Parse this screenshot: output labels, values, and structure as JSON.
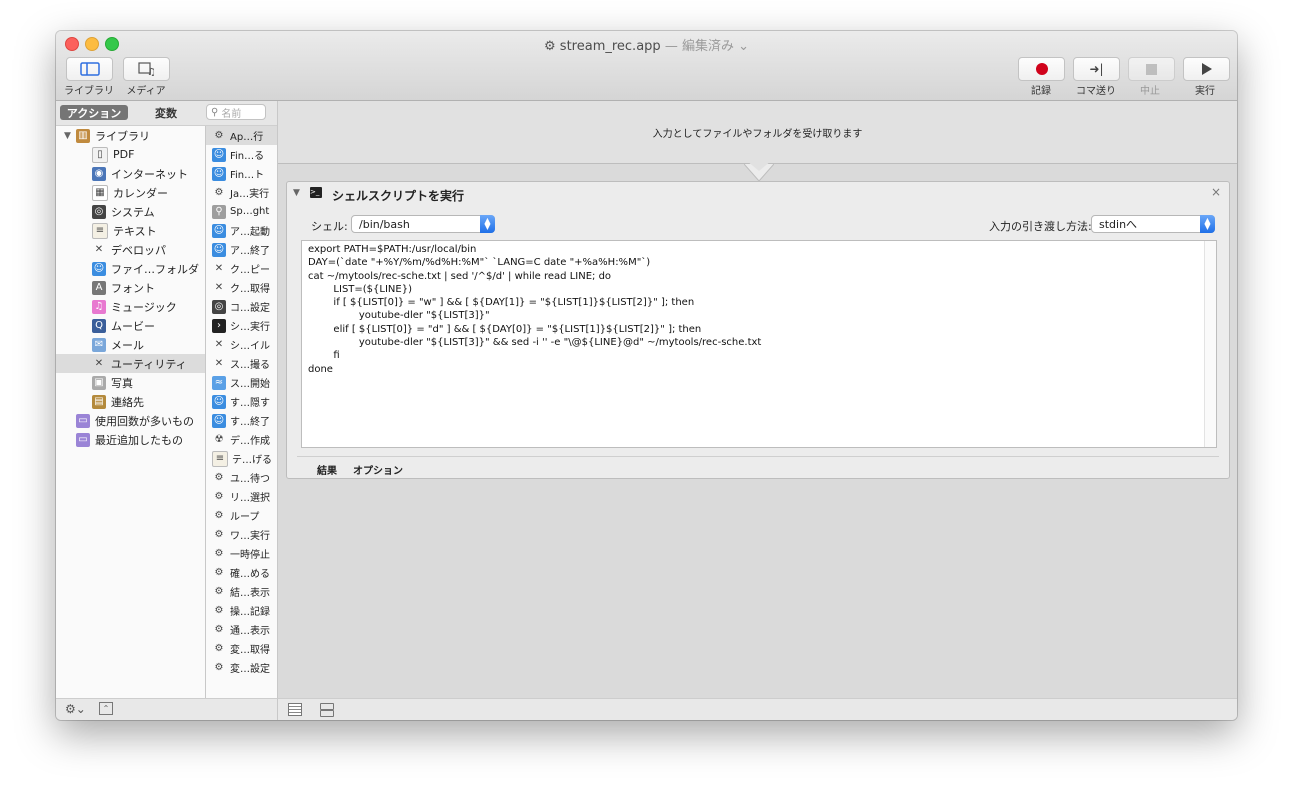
{
  "window": {
    "title": "stream_rec.app",
    "title_suffix": "— 編集済み ⌄"
  },
  "toolbar": {
    "library_label": "ライブラリ",
    "media_label": "メディア",
    "record_label": "記録",
    "step_label": "コマ送り",
    "stop_label": "中止",
    "run_label": "実行"
  },
  "sidebar": {
    "tab_actions": "アクション",
    "tab_variables": "変数",
    "search_placeholder": "名前",
    "library_items": [
      {
        "label": "ライブラリ",
        "icon": "library-icon"
      },
      {
        "label": "PDF",
        "icon": "pdf-icon"
      },
      {
        "label": "インターネット",
        "icon": "globe-icon"
      },
      {
        "label": "カレンダー",
        "icon": "calendar-icon"
      },
      {
        "label": "システム",
        "icon": "system-icon"
      },
      {
        "label": "テキスト",
        "icon": "text-icon"
      },
      {
        "label": "デベロッパ",
        "icon": "developer-icon"
      },
      {
        "label": "ファイ…フォルダ",
        "icon": "finder-icon"
      },
      {
        "label": "フォント",
        "icon": "font-icon"
      },
      {
        "label": "ミュージック",
        "icon": "music-icon"
      },
      {
        "label": "ムービー",
        "icon": "movie-icon"
      },
      {
        "label": "メール",
        "icon": "mail-icon"
      },
      {
        "label": "ユーティリティ",
        "icon": "utilities-icon"
      },
      {
        "label": "写真",
        "icon": "photos-icon"
      },
      {
        "label": "連絡先",
        "icon": "contacts-icon"
      },
      {
        "label": "使用回数が多いもの",
        "icon": "smart-folder-icon"
      },
      {
        "label": "最近追加したもの",
        "icon": "smart-folder-icon"
      }
    ],
    "actions": [
      {
        "label": "Ap…行",
        "icon": "automator-icon"
      },
      {
        "label": "Fin…る",
        "icon": "finder-icon"
      },
      {
        "label": "Fin…ト",
        "icon": "finder-icon"
      },
      {
        "label": "Ja…実行",
        "icon": "automator-icon"
      },
      {
        "label": "Sp…ght",
        "icon": "spotlight-icon"
      },
      {
        "label": "ア…起動",
        "icon": "finder-icon"
      },
      {
        "label": "ア…終了",
        "icon": "finder-icon"
      },
      {
        "label": "ク…ピー",
        "icon": "tools-icon"
      },
      {
        "label": "ク…取得",
        "icon": "tools-icon"
      },
      {
        "label": "コ…設定",
        "icon": "system-icon"
      },
      {
        "label": "シ…実行",
        "icon": "terminal-icon"
      },
      {
        "label": "シ…イル",
        "icon": "tools-icon"
      },
      {
        "label": "ス…撮る",
        "icon": "tools-icon"
      },
      {
        "label": "ス…開始",
        "icon": "screensaver-icon"
      },
      {
        "label": "す…隠す",
        "icon": "finder-icon"
      },
      {
        "label": "す…終了",
        "icon": "finder-icon"
      },
      {
        "label": "デ…作成",
        "icon": "radiation-icon"
      },
      {
        "label": "テ…げる",
        "icon": "text-icon"
      },
      {
        "label": "ユ…待つ",
        "icon": "automator-icon"
      },
      {
        "label": "リ…選択",
        "icon": "automator-icon"
      },
      {
        "label": "ループ",
        "icon": "automator-icon"
      },
      {
        "label": "ワ…実行",
        "icon": "automator-icon"
      },
      {
        "label": "一時停止",
        "icon": "automator-icon"
      },
      {
        "label": "確…める",
        "icon": "automator-icon"
      },
      {
        "label": "結…表示",
        "icon": "automator-icon"
      },
      {
        "label": "操…記録",
        "icon": "automator-icon"
      },
      {
        "label": "通…表示",
        "icon": "automator-icon"
      },
      {
        "label": "変…取得",
        "icon": "automator-icon"
      },
      {
        "label": "変…設定",
        "icon": "automator-icon"
      }
    ]
  },
  "workflow": {
    "input_text": "入力としてファイルやフォルダを受け取ります",
    "action_title": "シェルスクリプトを実行",
    "shell_label": "シェル:",
    "shell_value": "/bin/bash",
    "pass_input_label": "入力の引き渡し方法:",
    "pass_input_value": "stdinへ",
    "script": "export PATH=$PATH:/usr/local/bin\nDAY=(`date \"+%Y/%m/%d%H:%M\"` `LANG=C date \"+%a%H:%M\"`)\ncat ~/mytools/rec-sche.txt | sed '/^$/d' | while read LINE; do\n        LIST=(${LINE})\n        if [ ${LIST[0]} = \"w\" ] && [ ${DAY[1]} = \"${LIST[1]}${LIST[2]}\" ]; then\n                youtube-dler \"${LIST[3]}\"\n        elif [ ${LIST[0]} = \"d\" ] && [ ${DAY[0]} = \"${LIST[1]}${LIST[2]}\" ]; then\n                youtube-dler \"${LIST[3]}\" && sed -i '' -e \"\\@${LINE}@d\" ~/mytools/rec-sche.txt\n        fi\ndone",
    "tab_results": "結果",
    "tab_options": "オプション",
    "close_glyph": "×"
  }
}
